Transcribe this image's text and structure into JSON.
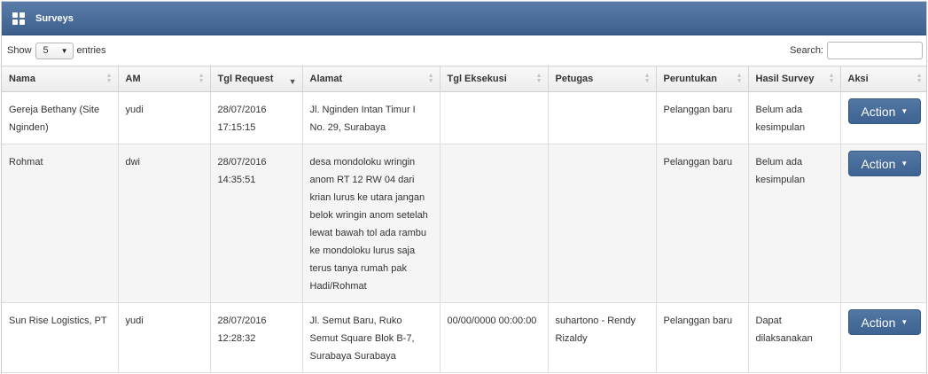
{
  "header": {
    "title": "Surveys",
    "icon": "grid-icon"
  },
  "toolbar": {
    "show_label": "Show",
    "length_value": "5",
    "entries_label": "entries",
    "search_label": "Search:",
    "search_value": ""
  },
  "columns": [
    "Nama",
    "AM",
    "Tgl Request",
    "Alamat",
    "Tgl Eksekusi",
    "Petugas",
    "Peruntukan",
    "Hasil Survey",
    "Aksi"
  ],
  "rows": [
    {
      "nama": "Gereja Bethany (Site Nginden)",
      "am": "yudi",
      "tgl_request": "28/07/2016 17:15:15",
      "alamat": "Jl. Nginden Intan Timur I No. 29, Surabaya",
      "tgl_eksekusi": "",
      "petugas": "",
      "peruntukan": "Pelanggan baru",
      "hasil_survey": "Belum ada kesimpulan",
      "action_label": "Action"
    },
    {
      "nama": "Rohmat",
      "am": "dwi",
      "tgl_request": "28/07/2016 14:35:51",
      "alamat": "desa mondoloku wringin anom RT 12 RW 04 dari krian lurus ke utara jangan belok wringin anom setelah lewat bawah tol ada rambu ke mondoloku lurus saja terus tanya rumah pak Hadi/Rohmat",
      "tgl_eksekusi": "",
      "petugas": "",
      "peruntukan": "Pelanggan baru",
      "hasil_survey": "Belum ada kesimpulan",
      "action_label": "Action"
    },
    {
      "nama": "Sun Rise Logistics, PT",
      "am": "yudi",
      "tgl_request": "28/07/2016 12:28:32",
      "alamat": "Jl. Semut Baru, Ruko Semut Square Blok B-7, Surabaya Surabaya",
      "tgl_eksekusi": "00/00/0000 00:00:00",
      "petugas": "suhartono - Rendy Rizaldy",
      "peruntukan": "Pelanggan baru",
      "hasil_survey": "Dapat dilaksanakan",
      "action_label": "Action"
    }
  ],
  "colors": {
    "header_bg": "#4a6c98",
    "button_bg": "#4a6d9a",
    "stripe": "#f5f5f5"
  }
}
